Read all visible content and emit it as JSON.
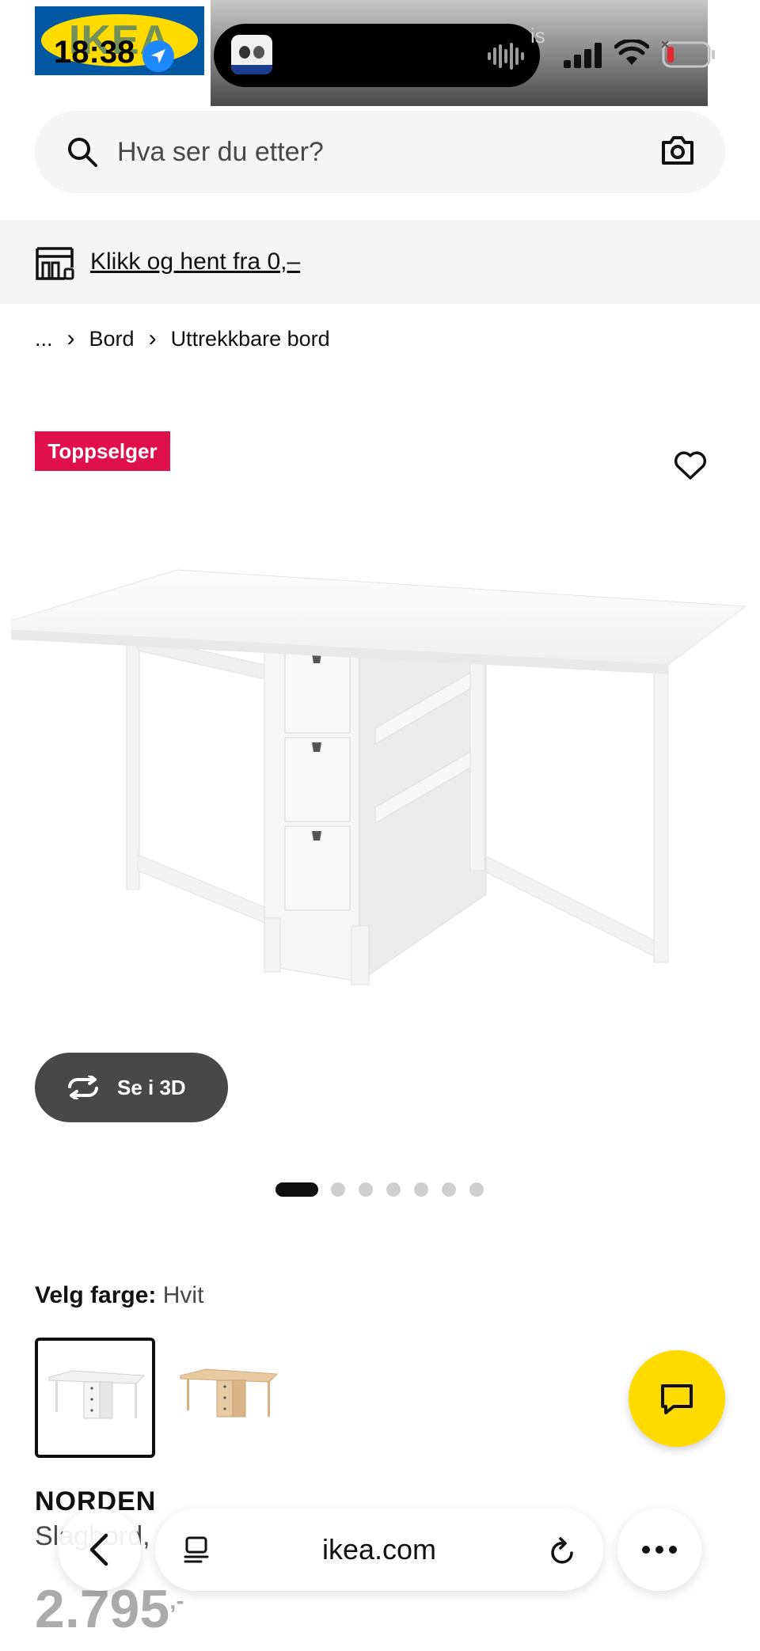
{
  "status_bar": {
    "time": "18:38",
    "logo_text": "IKEA",
    "faint_text": "is"
  },
  "search": {
    "placeholder": "Hva ser du etter?"
  },
  "collect": {
    "label": "Klikk og hent fra 0,–"
  },
  "breadcrumb": {
    "items": [
      "...",
      "Bord",
      "Uttrekkbare bord"
    ]
  },
  "product": {
    "badge": "Toppselger",
    "view_3d_label": "Se i 3D",
    "image_count": 7,
    "active_image": 1,
    "color_label": "Velg farge:",
    "color_value": "Hvit",
    "colors": [
      "white",
      "birch"
    ],
    "name": "NORDEN",
    "description": "Slagbord,",
    "price": "2.795",
    "price_suffix": ",-"
  },
  "browser": {
    "url": "ikea.com"
  },
  "colors": {
    "badge_bg": "#e0104f",
    "chat_fab": "#ffdb00",
    "button_3d": "#484848"
  }
}
